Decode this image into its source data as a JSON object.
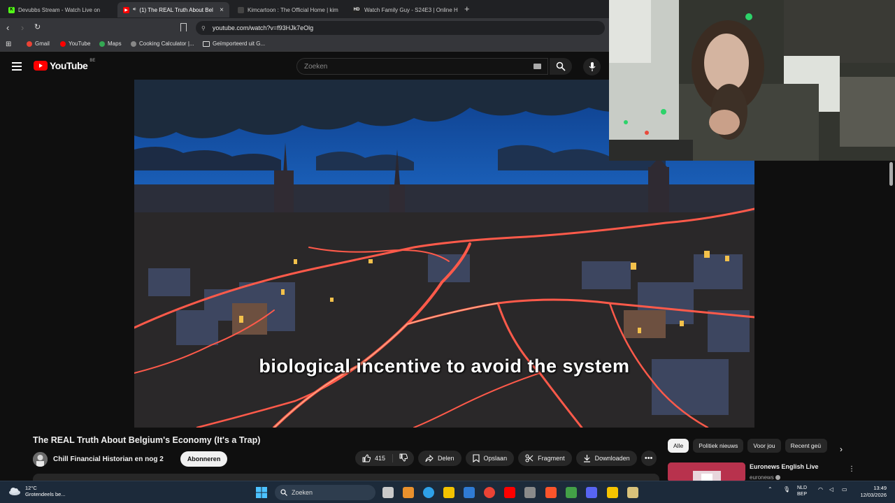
{
  "browser": {
    "tabs": [
      {
        "title": "Devubbs Stream - Watch Live on",
        "active": false,
        "color": "#53fc18",
        "glyph": "K"
      },
      {
        "title": "(1) The REAL Truth About Bel",
        "active": true,
        "color": "#ff0000",
        "glyph": "▶"
      },
      {
        "title": "Kimcartoon : The Official Home | kim",
        "active": false,
        "color": "#444444",
        "glyph": ""
      },
      {
        "title": "Watch Family Guy - S24E3 | Online H",
        "active": false,
        "color": "#222222",
        "glyph": "HD"
      }
    ],
    "new_tab": "+",
    "url": "youtube.com/watch?v=f93HJk7eOlg",
    "bookmarks": [
      {
        "label": "Gmail",
        "color": "#ea4335"
      },
      {
        "label": "YouTube",
        "color": "#ff0000"
      },
      {
        "label": "Maps",
        "color": "#34a853"
      },
      {
        "label": "Cooking Calculator |...",
        "color": "#888888"
      },
      {
        "label": "Geïmporteerd uit G...",
        "color": "#dddddd"
      }
    ]
  },
  "youtube": {
    "logo_text": "YouTube",
    "country_code": "BE",
    "search_placeholder": "Zoeken",
    "caption": "biological incentive to avoid the system",
    "video_title": "The REAL Truth About Belgium's Economy (It's a Trap)",
    "channel_name": "Chill Financial Historian en nog 2",
    "subscribe_label": "Abonneren",
    "like_count": "415",
    "actions": {
      "share": "Delen",
      "save": "Opslaan",
      "clip": "Fragment",
      "download": "Downloaden",
      "more": "•••"
    },
    "chips": [
      "Alle",
      "Politiek nieuws",
      "Voor jou",
      "Recent geü"
    ],
    "active_chip": "Alle",
    "recommendation": {
      "title": "Euronews English Live",
      "channel": "euronews"
    }
  },
  "taskbar": {
    "temperature": "12°C",
    "weather": "Grotendeels be...",
    "search_label": "Zoeken",
    "lang_top": "NLD",
    "lang_bottom": "BEP",
    "time": "13:49",
    "date": "12/03/2026",
    "icon_colors": [
      "#c9c9c9",
      "#e8912d",
      "#2ea0e8",
      "#f2c200",
      "#2f7bd4",
      "#ea4335",
      "#ff0000",
      "#8a8a8a",
      "#fb542b",
      "#43a047",
      "#5865f2",
      "#f6c400",
      "#d9c27a"
    ]
  }
}
